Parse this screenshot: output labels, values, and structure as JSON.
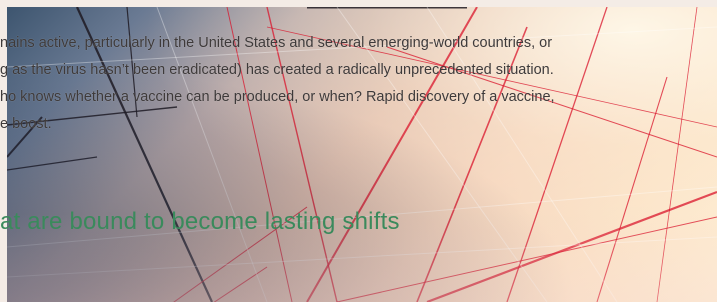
{
  "article": {
    "paragraph_lines": [
      "nains active, particularly in the United States and several emerging-world countries, or",
      "g as the virus hasn’t been eradicated) has created a radically unprecedented situation.",
      "ho knows whether a vaccine can be produced, or when? Rapid discovery of a vaccine,",
      "e boost."
    ],
    "subheading": "at are bound to become lasting shifts"
  },
  "background": {
    "description_icon": "architectural-glass-ceiling-image",
    "accent_line_color": "#d9142b",
    "heading_color": "#3a8a5c",
    "text_color": "#3e3a3a"
  }
}
